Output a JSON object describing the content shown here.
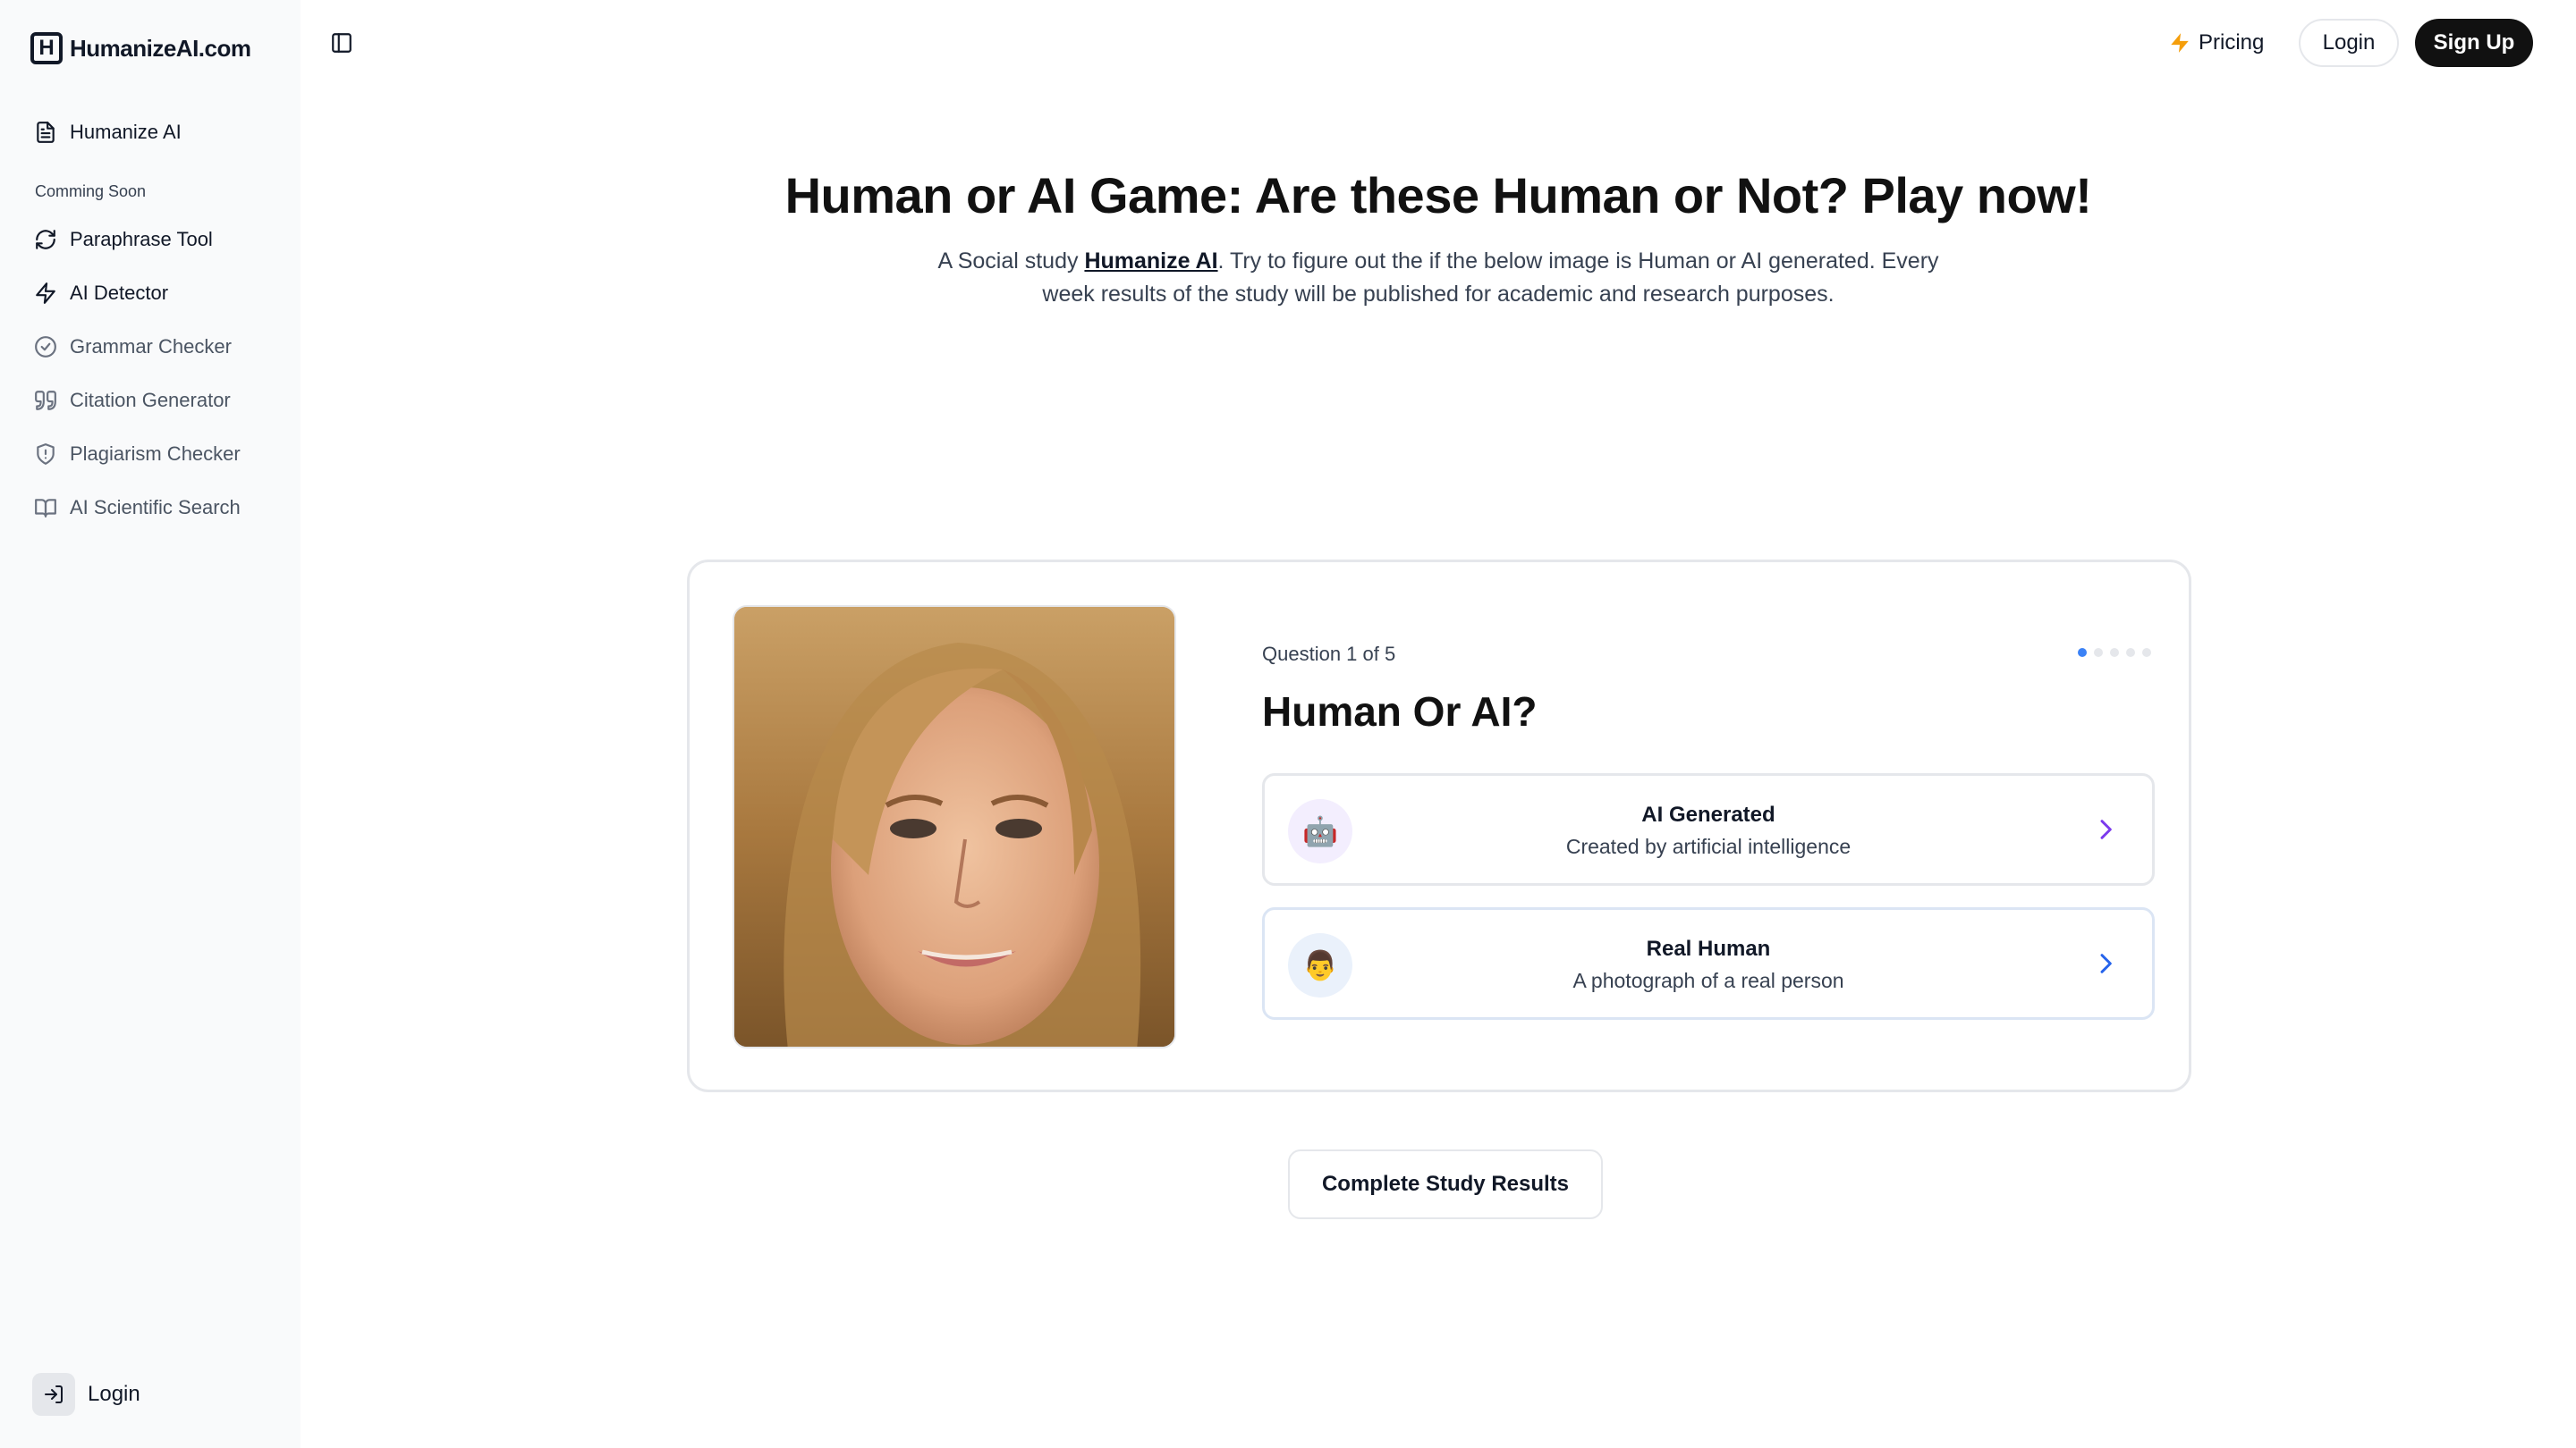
{
  "brand": {
    "logo_letter": "H",
    "name": "HumanizeAI.com"
  },
  "sidebar": {
    "primary": {
      "label": "Humanize AI",
      "icon": "document-icon"
    },
    "section_label": "Comming Soon",
    "items": [
      {
        "label": "Paraphrase Tool",
        "icon": "refresh-icon",
        "muted": false
      },
      {
        "label": "AI Detector",
        "icon": "lightning-icon",
        "muted": false
      },
      {
        "label": "Grammar Checker",
        "icon": "check-circle-icon",
        "muted": true
      },
      {
        "label": "Citation Generator",
        "icon": "quote-icon",
        "muted": true
      },
      {
        "label": "Plagiarism Checker",
        "icon": "shield-icon",
        "muted": true
      },
      {
        "label": "AI Scientific Search",
        "icon": "book-icon",
        "muted": true
      }
    ],
    "login_label": "Login"
  },
  "topbar": {
    "pricing_label": "Pricing",
    "login_label": "Login",
    "signup_label": "Sign Up"
  },
  "hero": {
    "title": "Human or AI Game: Are these Human or Not? Play now!",
    "subtitle_prefix": "A Social study ",
    "subtitle_link": "Humanize AI",
    "subtitle_suffix": ". Try to figure out the if the below image is Human or AI generated. Every week results of the study will be published for academic and research purposes."
  },
  "quiz": {
    "question_label": "Question 1 of 5",
    "current_question": 1,
    "total_questions": 5,
    "title": "Human Or AI?",
    "options": [
      {
        "title": "AI Generated",
        "description": "Created by artificial intelligence",
        "emoji": "🤖"
      },
      {
        "title": "Real Human",
        "description": "A photograph of a real person",
        "emoji": "👨"
      }
    ],
    "colors": {
      "active_dot": "#3b82f6",
      "ai_chevron": "#7c3aed",
      "human_chevron": "#2563eb"
    }
  },
  "results_button_label": "Complete Study Results"
}
